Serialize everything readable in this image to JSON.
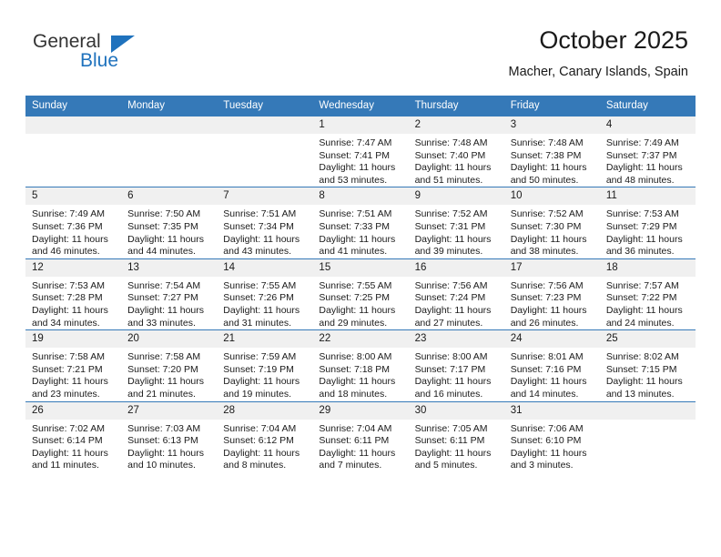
{
  "logo": {
    "text_primary": "General",
    "text_secondary": "Blue",
    "triangle_color": "#1f72bd"
  },
  "header": {
    "title": "October 2025",
    "subtitle": "Macher, Canary Islands, Spain"
  },
  "colors": {
    "header_row": "#3579b8",
    "day_number_band": "#f0f0f0",
    "text": "#1a1a1a"
  },
  "calendar": {
    "weekday_headers": [
      "Sunday",
      "Monday",
      "Tuesday",
      "Wednesday",
      "Thursday",
      "Friday",
      "Saturday"
    ],
    "weeks": [
      [
        {
          "day": "",
          "empty": true
        },
        {
          "day": "",
          "empty": true
        },
        {
          "day": "",
          "empty": true
        },
        {
          "day": "1",
          "sunrise": "Sunrise: 7:47 AM",
          "sunset": "Sunset: 7:41 PM",
          "daylight_line1": "Daylight: 11 hours",
          "daylight_line2": "and 53 minutes."
        },
        {
          "day": "2",
          "sunrise": "Sunrise: 7:48 AM",
          "sunset": "Sunset: 7:40 PM",
          "daylight_line1": "Daylight: 11 hours",
          "daylight_line2": "and 51 minutes."
        },
        {
          "day": "3",
          "sunrise": "Sunrise: 7:48 AM",
          "sunset": "Sunset: 7:38 PM",
          "daylight_line1": "Daylight: 11 hours",
          "daylight_line2": "and 50 minutes."
        },
        {
          "day": "4",
          "sunrise": "Sunrise: 7:49 AM",
          "sunset": "Sunset: 7:37 PM",
          "daylight_line1": "Daylight: 11 hours",
          "daylight_line2": "and 48 minutes."
        }
      ],
      [
        {
          "day": "5",
          "sunrise": "Sunrise: 7:49 AM",
          "sunset": "Sunset: 7:36 PM",
          "daylight_line1": "Daylight: 11 hours",
          "daylight_line2": "and 46 minutes."
        },
        {
          "day": "6",
          "sunrise": "Sunrise: 7:50 AM",
          "sunset": "Sunset: 7:35 PM",
          "daylight_line1": "Daylight: 11 hours",
          "daylight_line2": "and 44 minutes."
        },
        {
          "day": "7",
          "sunrise": "Sunrise: 7:51 AM",
          "sunset": "Sunset: 7:34 PM",
          "daylight_line1": "Daylight: 11 hours",
          "daylight_line2": "and 43 minutes."
        },
        {
          "day": "8",
          "sunrise": "Sunrise: 7:51 AM",
          "sunset": "Sunset: 7:33 PM",
          "daylight_line1": "Daylight: 11 hours",
          "daylight_line2": "and 41 minutes."
        },
        {
          "day": "9",
          "sunrise": "Sunrise: 7:52 AM",
          "sunset": "Sunset: 7:31 PM",
          "daylight_line1": "Daylight: 11 hours",
          "daylight_line2": "and 39 minutes."
        },
        {
          "day": "10",
          "sunrise": "Sunrise: 7:52 AM",
          "sunset": "Sunset: 7:30 PM",
          "daylight_line1": "Daylight: 11 hours",
          "daylight_line2": "and 38 minutes."
        },
        {
          "day": "11",
          "sunrise": "Sunrise: 7:53 AM",
          "sunset": "Sunset: 7:29 PM",
          "daylight_line1": "Daylight: 11 hours",
          "daylight_line2": "and 36 minutes."
        }
      ],
      [
        {
          "day": "12",
          "sunrise": "Sunrise: 7:53 AM",
          "sunset": "Sunset: 7:28 PM",
          "daylight_line1": "Daylight: 11 hours",
          "daylight_line2": "and 34 minutes."
        },
        {
          "day": "13",
          "sunrise": "Sunrise: 7:54 AM",
          "sunset": "Sunset: 7:27 PM",
          "daylight_line1": "Daylight: 11 hours",
          "daylight_line2": "and 33 minutes."
        },
        {
          "day": "14",
          "sunrise": "Sunrise: 7:55 AM",
          "sunset": "Sunset: 7:26 PM",
          "daylight_line1": "Daylight: 11 hours",
          "daylight_line2": "and 31 minutes."
        },
        {
          "day": "15",
          "sunrise": "Sunrise: 7:55 AM",
          "sunset": "Sunset: 7:25 PM",
          "daylight_line1": "Daylight: 11 hours",
          "daylight_line2": "and 29 minutes."
        },
        {
          "day": "16",
          "sunrise": "Sunrise: 7:56 AM",
          "sunset": "Sunset: 7:24 PM",
          "daylight_line1": "Daylight: 11 hours",
          "daylight_line2": "and 27 minutes."
        },
        {
          "day": "17",
          "sunrise": "Sunrise: 7:56 AM",
          "sunset": "Sunset: 7:23 PM",
          "daylight_line1": "Daylight: 11 hours",
          "daylight_line2": "and 26 minutes."
        },
        {
          "day": "18",
          "sunrise": "Sunrise: 7:57 AM",
          "sunset": "Sunset: 7:22 PM",
          "daylight_line1": "Daylight: 11 hours",
          "daylight_line2": "and 24 minutes."
        }
      ],
      [
        {
          "day": "19",
          "sunrise": "Sunrise: 7:58 AM",
          "sunset": "Sunset: 7:21 PM",
          "daylight_line1": "Daylight: 11 hours",
          "daylight_line2": "and 23 minutes."
        },
        {
          "day": "20",
          "sunrise": "Sunrise: 7:58 AM",
          "sunset": "Sunset: 7:20 PM",
          "daylight_line1": "Daylight: 11 hours",
          "daylight_line2": "and 21 minutes."
        },
        {
          "day": "21",
          "sunrise": "Sunrise: 7:59 AM",
          "sunset": "Sunset: 7:19 PM",
          "daylight_line1": "Daylight: 11 hours",
          "daylight_line2": "and 19 minutes."
        },
        {
          "day": "22",
          "sunrise": "Sunrise: 8:00 AM",
          "sunset": "Sunset: 7:18 PM",
          "daylight_line1": "Daylight: 11 hours",
          "daylight_line2": "and 18 minutes."
        },
        {
          "day": "23",
          "sunrise": "Sunrise: 8:00 AM",
          "sunset": "Sunset: 7:17 PM",
          "daylight_line1": "Daylight: 11 hours",
          "daylight_line2": "and 16 minutes."
        },
        {
          "day": "24",
          "sunrise": "Sunrise: 8:01 AM",
          "sunset": "Sunset: 7:16 PM",
          "daylight_line1": "Daylight: 11 hours",
          "daylight_line2": "and 14 minutes."
        },
        {
          "day": "25",
          "sunrise": "Sunrise: 8:02 AM",
          "sunset": "Sunset: 7:15 PM",
          "daylight_line1": "Daylight: 11 hours",
          "daylight_line2": "and 13 minutes."
        }
      ],
      [
        {
          "day": "26",
          "sunrise": "Sunrise: 7:02 AM",
          "sunset": "Sunset: 6:14 PM",
          "daylight_line1": "Daylight: 11 hours",
          "daylight_line2": "and 11 minutes."
        },
        {
          "day": "27",
          "sunrise": "Sunrise: 7:03 AM",
          "sunset": "Sunset: 6:13 PM",
          "daylight_line1": "Daylight: 11 hours",
          "daylight_line2": "and 10 minutes."
        },
        {
          "day": "28",
          "sunrise": "Sunrise: 7:04 AM",
          "sunset": "Sunset: 6:12 PM",
          "daylight_line1": "Daylight: 11 hours",
          "daylight_line2": "and 8 minutes."
        },
        {
          "day": "29",
          "sunrise": "Sunrise: 7:04 AM",
          "sunset": "Sunset: 6:11 PM",
          "daylight_line1": "Daylight: 11 hours",
          "daylight_line2": "and 7 minutes."
        },
        {
          "day": "30",
          "sunrise": "Sunrise: 7:05 AM",
          "sunset": "Sunset: 6:11 PM",
          "daylight_line1": "Daylight: 11 hours",
          "daylight_line2": "and 5 minutes."
        },
        {
          "day": "31",
          "sunrise": "Sunrise: 7:06 AM",
          "sunset": "Sunset: 6:10 PM",
          "daylight_line1": "Daylight: 11 hours",
          "daylight_line2": "and 3 minutes."
        },
        {
          "day": "",
          "empty": true
        }
      ]
    ]
  }
}
